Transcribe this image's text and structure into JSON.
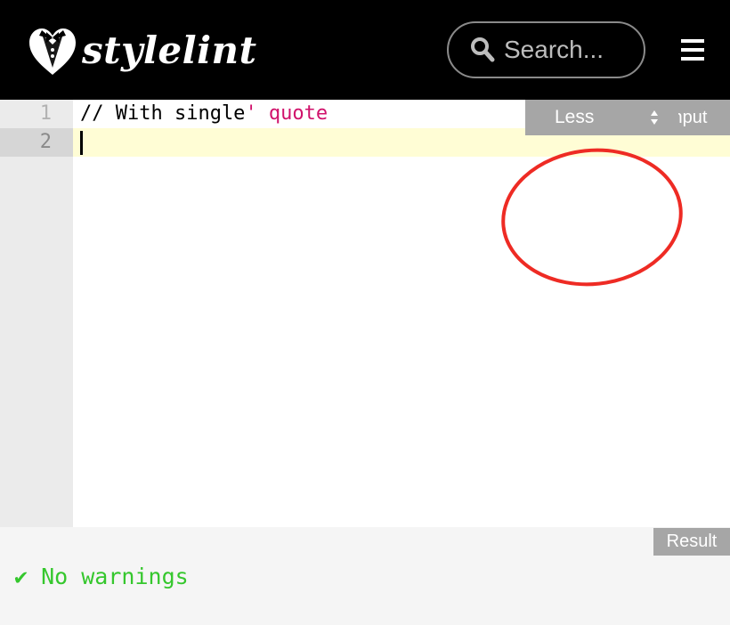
{
  "header": {
    "logo_text": "stylelint",
    "logo_icon": "tuxedo-heart-icon",
    "search_placeholder": "Search...",
    "search_icon": "search-icon",
    "menu_icon": "hamburger-menu-icon"
  },
  "editor": {
    "lines": [
      {
        "number": "1",
        "text": "// With single",
        "string": "' quote"
      },
      {
        "number": "2",
        "text": "",
        "string": ""
      }
    ],
    "active_line": 2,
    "syntax_select": {
      "selected": "Less"
    },
    "panel_label": "Input"
  },
  "result": {
    "panel_label": "Result",
    "message": "✔ No warnings"
  },
  "colors": {
    "header_bg": "#000000",
    "string_color": "#d0126b",
    "success_color": "#35c72d",
    "active_line_bg": "#fffdd5",
    "annotation_circle": "#ee2b24"
  }
}
